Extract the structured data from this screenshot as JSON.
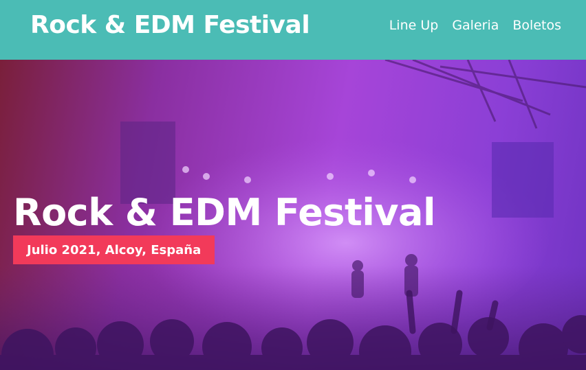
{
  "header": {
    "logo": "Rock & EDM Festival",
    "nav": [
      "Line Up",
      "Galeria",
      "Boletos"
    ],
    "background_color": "#4bbcb5"
  },
  "hero": {
    "title": "Rock & EDM Festival",
    "badge": "Julio 2021, Alcoy, España",
    "badge_color": "#f23a5a",
    "image": "concert-crowd-stage-lights-purple-overlay"
  }
}
